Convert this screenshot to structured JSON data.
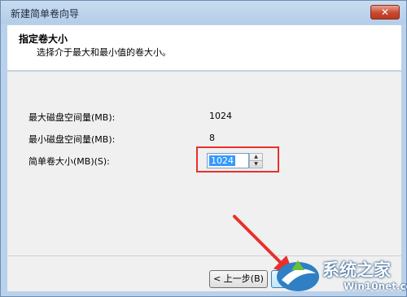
{
  "window": {
    "title": "新建简单卷向导",
    "close_label": "✕"
  },
  "header": {
    "title": "指定卷大小",
    "subtitle": "选择介于最大和最小值的卷大小。"
  },
  "fields": [
    {
      "label": "最大磁盘空间量(MB):",
      "value": "1024"
    },
    {
      "label": "最小磁盘空间量(MB):",
      "value": "8"
    },
    {
      "label": "简单卷大小(MB)(S):",
      "value": "1024"
    }
  ],
  "footer": {
    "back_label": "< 上一步(B)"
  },
  "watermark": {
    "title": "系统之家",
    "url": "Win10net.com"
  },
  "colors": {
    "highlight": "#e8312a",
    "arrow": "#e8312a",
    "selection": "#3399ff"
  }
}
